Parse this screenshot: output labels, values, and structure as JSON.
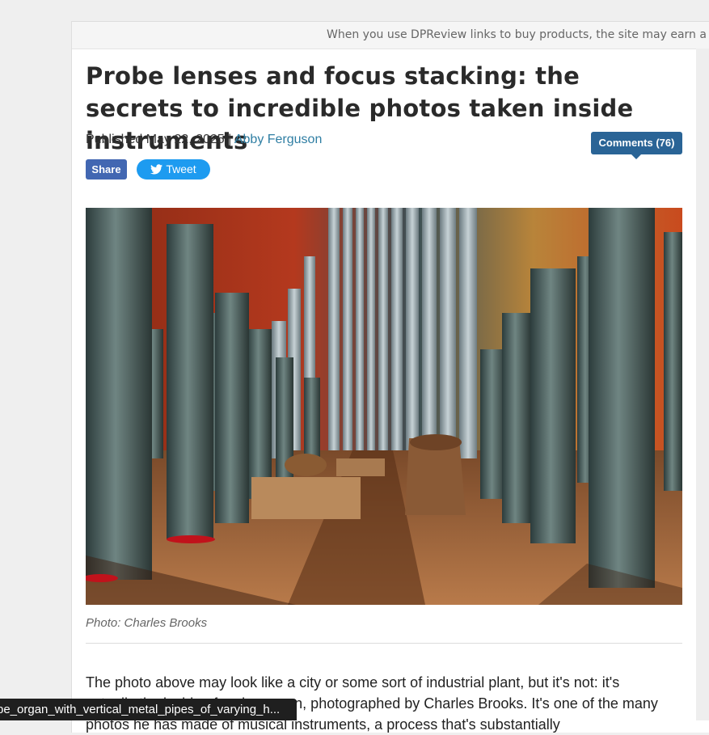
{
  "disclaimer": "When you use DPReview links to buy products, the site may earn a c",
  "article": {
    "title": "Probe lenses and focus stacking: the secrets to incredible photos taken inside instruments",
    "published_prefix": "Published May 22, 2025 | ",
    "author": "Abby Ferguson",
    "comments_label": "Comments (76)",
    "share_label": "Share",
    "tweet_label": "Tweet",
    "photo_caption": "Photo: Charles Brooks",
    "body_line1": "The photo above may look like a city or some sort of industrial plant, but it's not: it's",
    "body_line2": "actually the inside of a pipe organ, photographed by Charles Brooks. It's one of the many",
    "body_line3": "photos he has made of musical instruments, a process that's substantially"
  },
  "status_bar": {
    "link_text": "pe_organ_with_vertical_metal_pipes_of_varying_h..."
  },
  "colors": {
    "accent": "#2a6496",
    "author_link": "#2f7ea3",
    "facebook": "#4267b2",
    "twitter": "#1d9bf0"
  },
  "icons": [
    "twitter-bird-icon"
  ]
}
